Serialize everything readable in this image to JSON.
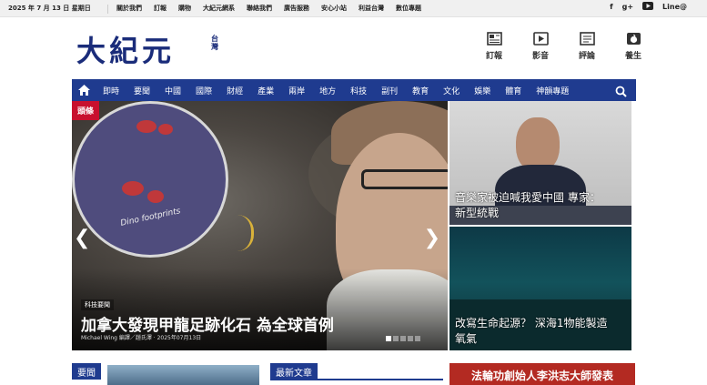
{
  "topbar": {
    "date": "2025 年 7 月 13 日 星期日",
    "links": [
      "關於我們",
      "訂報",
      "購物",
      "大紀元網系",
      "聯絡我們",
      "廣告服務",
      "安心小站",
      "利益台灣",
      "數位專題"
    ],
    "social": {
      "facebook": "f",
      "googleplus": "g+",
      "line": "Line@"
    }
  },
  "logo": {
    "main": "大紀元",
    "region": "台灣"
  },
  "tools": [
    {
      "label": "訂報",
      "icon": "newspaper-icon"
    },
    {
      "label": "影音",
      "icon": "video-icon"
    },
    {
      "label": "評論",
      "icon": "comment-icon"
    },
    {
      "label": "養生",
      "icon": "apple-icon"
    }
  ],
  "nav": {
    "items": [
      "即時",
      "要聞",
      "中國",
      "國際",
      "財經",
      "產業",
      "兩岸",
      "地方",
      "科技",
      "副刊",
      "教育",
      "文化",
      "娛樂",
      "體育",
      "神韻專題"
    ]
  },
  "hero": {
    "tag": "頭條",
    "category": "科技要聞",
    "title": "加拿大發現甲龍足跡化石 為全球首例",
    "byline": "Michael Wing 編譯／趙氏澤 · 2025年07月13日",
    "image_note": "Dino footprints",
    "dots": 5,
    "active_dot": 0
  },
  "side": [
    {
      "caption_l1": "音樂家被迫喊我愛中國 專家：",
      "caption_l2": "新型統戰"
    },
    {
      "caption_l1": "改寫生命起源？ 深海1物能製造",
      "caption_l2": "氧氣"
    }
  ],
  "sections": {
    "news": "要聞",
    "latest": "最新文章"
  },
  "banner": {
    "text": "法輪功創始人李洪志大師發表"
  },
  "colors": {
    "brand": "#1f3b8f",
    "tag": "#c8102e",
    "banner": "#b32a22"
  }
}
